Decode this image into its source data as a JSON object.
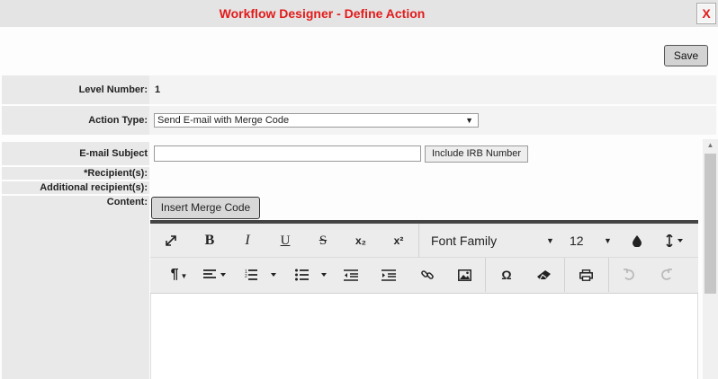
{
  "window": {
    "title": "Workflow Designer - Define Action",
    "close_label": "X"
  },
  "actions": {
    "save_label": "Save"
  },
  "form": {
    "level_number_label": "Level Number:",
    "level_number_value": "1",
    "action_type_label": "Action Type:",
    "action_type_value": "Send E-mail with Merge Code",
    "email_subject_label": "E-mail Subject",
    "email_subject_value": "",
    "include_irb_label": "Include IRB Number",
    "recipients_label": "*Recipient(s):",
    "additional_recipients_label": "Additional recipient(s):",
    "content_label": "Content:",
    "insert_merge_code_label": "Insert Merge Code"
  },
  "editor": {
    "toolbar_row1": [
      "fullscreen-icon",
      "bold-icon",
      "italic-icon",
      "underline-icon",
      "strikethrough-icon",
      "subscript-icon",
      "superscript-icon"
    ],
    "bold_glyph": "B",
    "italic_glyph": "I",
    "underline_glyph": "U",
    "strike_glyph": "S",
    "subscript_glyph": "x₂",
    "superscript_glyph": "x²",
    "font_family_label": "Font Family",
    "font_size_value": "12",
    "omega_glyph": "Ω",
    "paragraph_glyph": "¶",
    "content": ""
  },
  "colors": {
    "title": "#e21b1b",
    "label_bg": "#e9e9e9",
    "toolbar_bg": "#ececec",
    "editor_top_border": "#444444"
  }
}
